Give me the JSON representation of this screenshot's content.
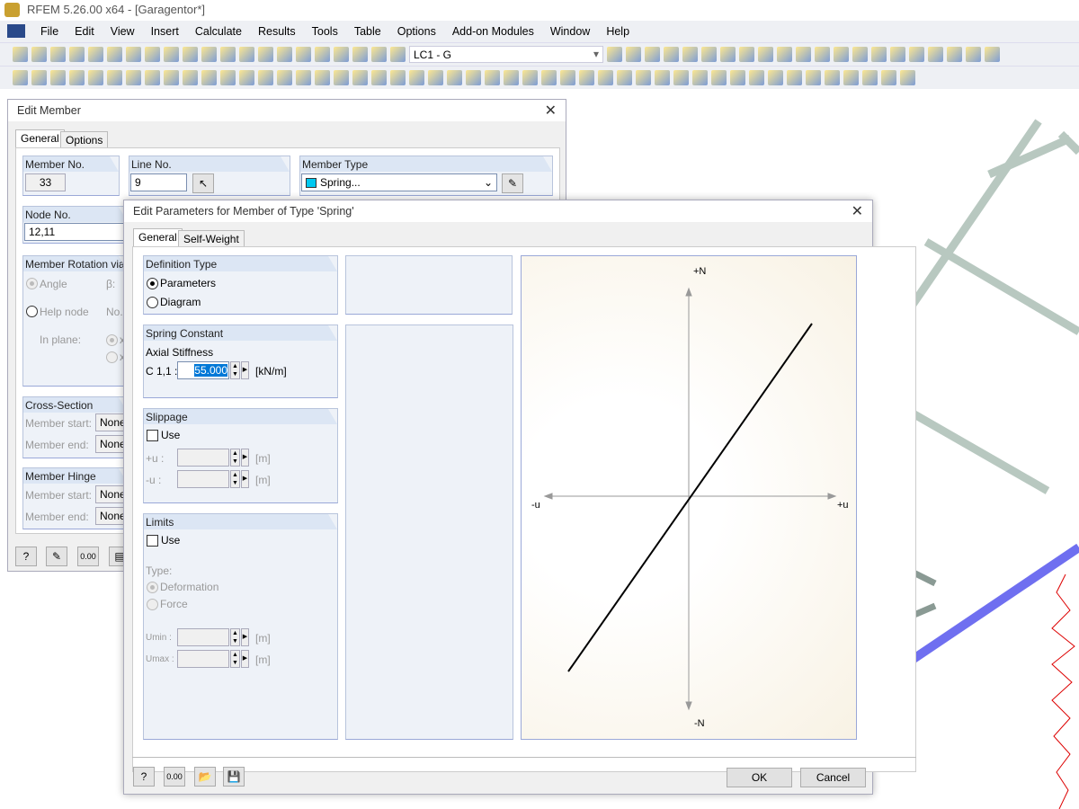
{
  "app": {
    "title": "RFEM 5.26.00 x64 - [Garagentor*]"
  },
  "menu": [
    "File",
    "Edit",
    "View",
    "Insert",
    "Calculate",
    "Results",
    "Tools",
    "Table",
    "Options",
    "Add-on Modules",
    "Window",
    "Help"
  ],
  "toolbar": {
    "load_case": "LC1 - G"
  },
  "edit_member": {
    "title": "Edit Member",
    "tabs": [
      "General",
      "Options"
    ],
    "member_no": {
      "label": "Member No.",
      "value": "33"
    },
    "line_no": {
      "label": "Line No.",
      "value": "9"
    },
    "member_type": {
      "label": "Member Type",
      "value": "Spring...",
      "color": "#00c8f0"
    },
    "node_no": {
      "label": "Node No.",
      "value": "12,11"
    },
    "rotation": {
      "label": "Member Rotation via",
      "angle": "Angle",
      "beta": "β:",
      "help_node": "Help node",
      "no": "No.:",
      "in_plane": "In plane:",
      "x1": "x",
      "x2": "x"
    },
    "cross_section": {
      "label": "Cross-Section",
      "start": "Member start:",
      "end": "Member end:",
      "start_value": "None",
      "end_value": "None"
    },
    "hinge": {
      "label": "Member Hinge",
      "start": "Member start:",
      "end": "Member end:",
      "start_value": "None",
      "end_value": "None"
    }
  },
  "spring_dialog": {
    "title": "Edit Parameters for Member of Type 'Spring'",
    "tabs": [
      "General",
      "Self-Weight"
    ],
    "definition": {
      "label": "Definition Type",
      "options": [
        "Parameters",
        "Diagram"
      ],
      "selected": "Parameters"
    },
    "spring_constant": {
      "label": "Spring Constant",
      "axial": "Axial Stiffness",
      "symbol": "C 1,1 :",
      "value": "55.000",
      "unit": "[kN/m]"
    },
    "slippage": {
      "label": "Slippage",
      "use": "Use",
      "plus_u": "+u :",
      "minus_u": "-u :",
      "unit": "[m]",
      "checked": false
    },
    "limits": {
      "label": "Limits",
      "use": "Use",
      "type": "Type:",
      "deformation": "Deformation",
      "force": "Force",
      "umin": "Umin :",
      "umax": "Umax :",
      "unit": "[m]",
      "checked": false
    },
    "diagram": {
      "plus_n": "+N",
      "minus_n": "-N",
      "minus_u": "-u",
      "plus_u": "+u"
    },
    "ok": "OK",
    "cancel": "Cancel"
  }
}
